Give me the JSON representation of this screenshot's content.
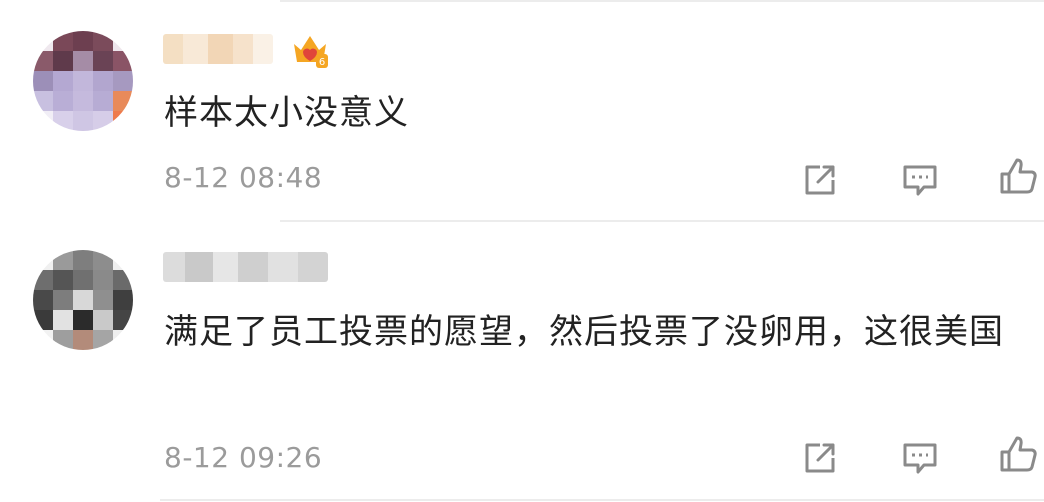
{
  "comments": [
    {
      "username": "",
      "text": "样本太小没意义",
      "time": "8-12 08:48",
      "has_vip_badge": true,
      "vip_level": "6",
      "actions": [
        "share-icon",
        "comment-icon",
        "like-icon"
      ]
    },
    {
      "username": "",
      "text": "满足了员工投票的愿望，然后投票了没卵用，这很美国",
      "time": "8-12 09:26",
      "has_vip_badge": false,
      "actions": [
        "share-icon",
        "comment-icon",
        "like-icon"
      ]
    }
  ],
  "colors": {
    "text": "#222222",
    "timestamp": "#9b9b9b",
    "icon": "#8a8a8a",
    "divider": "#ececec",
    "badge_orange": "#f5a623",
    "badge_red": "#e0453a"
  }
}
